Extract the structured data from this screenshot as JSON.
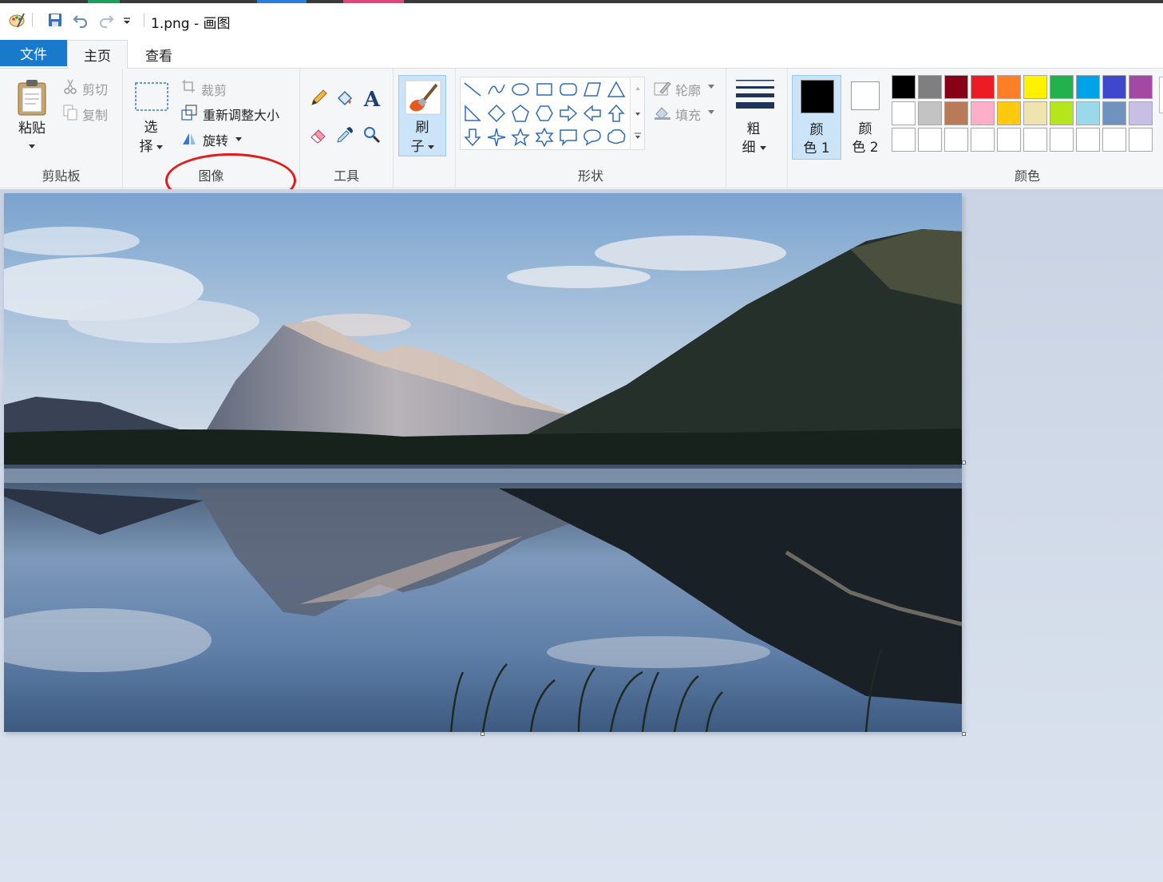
{
  "window": {
    "title": "1.png - 画图"
  },
  "tabs": {
    "file": "文件",
    "home": "主页",
    "view": "查看"
  },
  "clipboard": {
    "paste": "粘贴",
    "cut": "剪切",
    "copy": "复制",
    "label": "剪贴板"
  },
  "image": {
    "select_line1": "选",
    "select_line2": "择",
    "crop": "裁剪",
    "resize": "重新调整大小",
    "rotate": "旋转",
    "label": "图像"
  },
  "tools": {
    "label": "工具"
  },
  "brushes": {
    "line1": "刷",
    "line2": "子"
  },
  "shapes": {
    "outline": "轮廓",
    "fill": "填充",
    "label": "形状"
  },
  "size": {
    "line1": "粗",
    "line2": "细"
  },
  "colors": {
    "color1_line1": "颜",
    "color1_line2": "色 1",
    "color2_line1": "颜",
    "color2_line2": "色 2",
    "label": "颜色",
    "color1": "#000000",
    "color2": "#ffffff",
    "palette_row1": [
      "#000000",
      "#7f7f7f",
      "#880015",
      "#ed1c24",
      "#ff7f27",
      "#fff200",
      "#22b14c",
      "#00a2e8",
      "#3f48cc",
      "#a349a4"
    ],
    "palette_row2": [
      "#ffffff",
      "#c3c3c3",
      "#b97a57",
      "#ffaec9",
      "#ffc90e",
      "#efe4b0",
      "#b5e61d",
      "#99d9ea",
      "#7092be",
      "#c8bfe7"
    ],
    "palette_row3": [
      "#ffffff",
      "#ffffff",
      "#ffffff",
      "#ffffff",
      "#ffffff",
      "#ffffff",
      "#ffffff",
      "#ffffff",
      "#ffffff",
      "#ffffff"
    ]
  },
  "icons": {
    "app": "paint-app-icon",
    "save": "save-icon",
    "undo": "undo-icon",
    "redo": "redo-icon",
    "customize": "quick-access-dropdown-icon",
    "paste": "clipboard-icon",
    "cut": "scissors-icon",
    "copy": "copy-icon",
    "select": "selection-rectangle-icon",
    "crop": "crop-icon",
    "resize": "resize-icon",
    "rotate": "rotate-icon",
    "pencil": "pencil-icon",
    "fill_bucket": "fill-bucket-icon",
    "text": "text-icon",
    "eraser": "eraser-icon",
    "color_picker": "color-picker-icon",
    "magnifier": "magnifier-icon",
    "brush": "brush-icon",
    "size": "line-size-icon"
  },
  "annotation": {
    "color": "#e31b1b"
  }
}
